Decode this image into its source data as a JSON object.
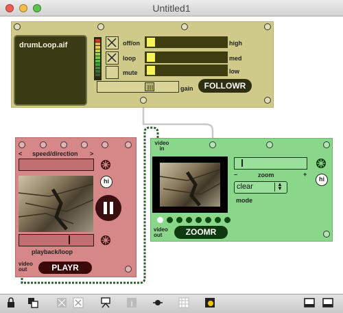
{
  "window": {
    "title": "Untitled1"
  },
  "followr": {
    "file_name": "drumLoop.aif",
    "rows": [
      {
        "label": "off/on",
        "side": "high",
        "checked": true
      },
      {
        "label": "loop",
        "side": "med",
        "checked": true
      },
      {
        "label": "mute",
        "side": "low",
        "checked": false
      }
    ],
    "gain_label": "gain",
    "module_name": "FOLLOWR"
  },
  "playr": {
    "speed_label": "speed/direction",
    "left_arrow": "<",
    "right_arrow": ">",
    "hi_label": "hi",
    "playback_label": "playback/loop",
    "video_out_label": "video out",
    "module_name": "PLAYR"
  },
  "zoomr": {
    "video_in_label": "video in",
    "zoom_label": "zoom",
    "minus": "–",
    "plus": "+",
    "mode_value": "clear",
    "mode_label": "mode",
    "hi_label": "hi",
    "video_out_label": "video out",
    "module_name": "ZOOMR"
  },
  "icons": {
    "traffic_lights": [
      "close-icon",
      "minimize-icon",
      "zoom-icon"
    ],
    "toolbar": [
      "lock-icon",
      "presentation-icon",
      "bpatcher-icon",
      "delete-icon",
      "easel-icon",
      "info-icon",
      "connect-icon",
      "grid-icon",
      "clue-icon",
      "split-left-icon",
      "split-right-icon"
    ]
  },
  "colors": {
    "followr_bg": "#cfca8a",
    "playr_bg": "#d68787",
    "zoomr_bg": "#8ad68a"
  }
}
